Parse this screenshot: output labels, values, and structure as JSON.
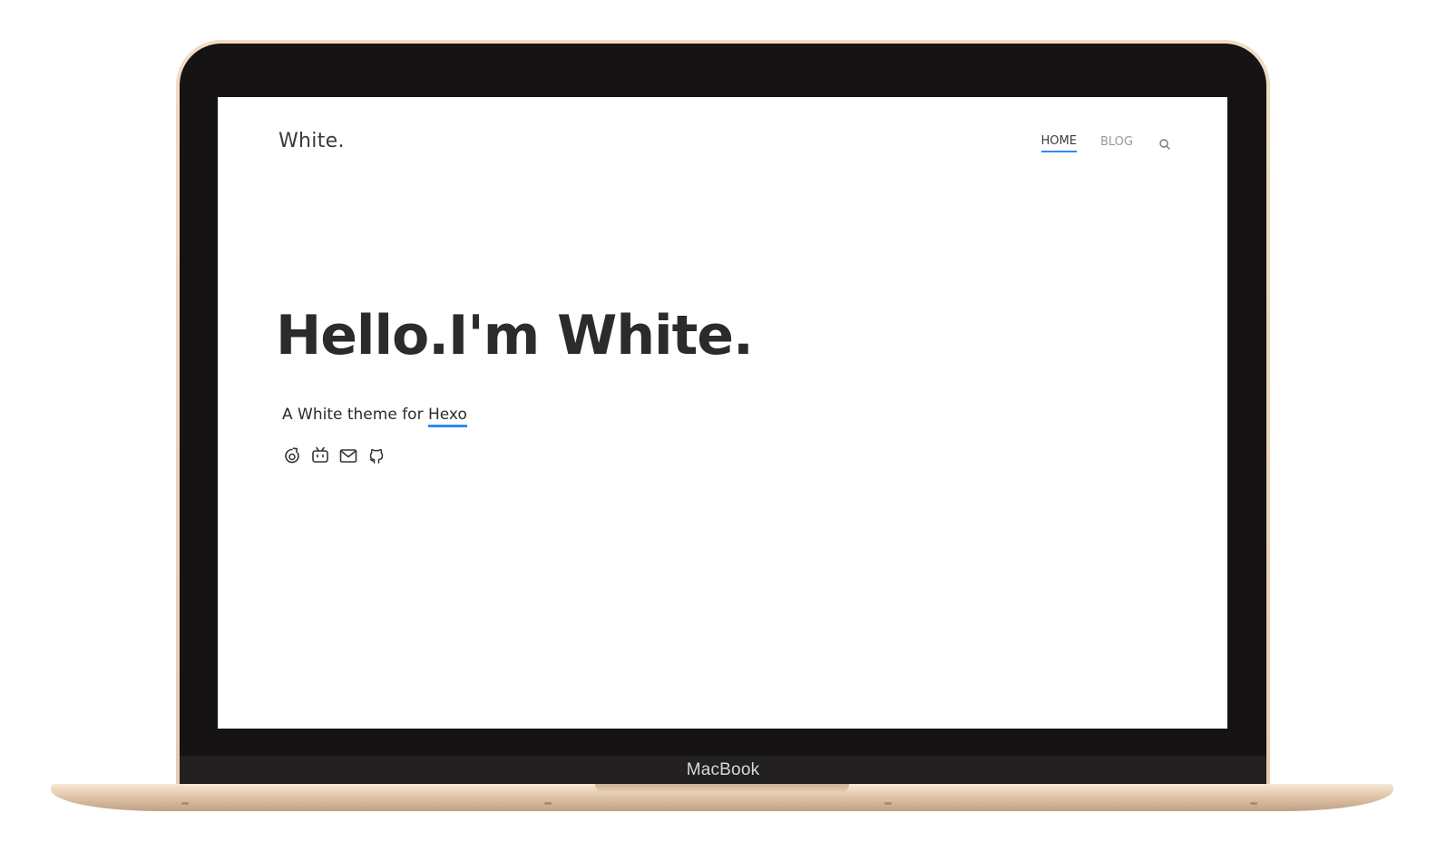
{
  "device": {
    "label": "MacBook"
  },
  "site": {
    "logo": "White.",
    "nav": {
      "home_label": "HOME",
      "blog_label": "BLOG",
      "search_icon": "search-icon",
      "active": "HOME"
    },
    "hero": {
      "title": "Hello.I'm White.",
      "tagline_prefix": "A White theme for ",
      "tagline_link": "Hexo"
    },
    "social_icons": [
      "weibo-icon",
      "bilibili-icon",
      "mail-icon",
      "github-icon"
    ]
  },
  "colors": {
    "accent": "#2d8cf0",
    "text": "#2b2b2b",
    "nav_inactive": "#999999",
    "laptop_gold": "#e6ccb2",
    "bezel": "#151313"
  }
}
